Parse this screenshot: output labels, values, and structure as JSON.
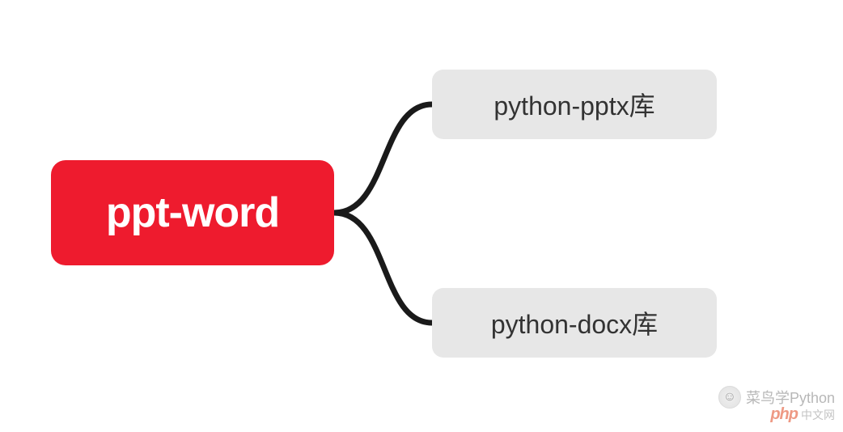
{
  "diagram": {
    "root": {
      "label": "ppt-word",
      "color": "#ee1b2e",
      "text_color": "#ffffff"
    },
    "children": [
      {
        "label": "python-pptx库",
        "color": "#e7e7e7",
        "text_color": "#333333"
      },
      {
        "label": "python-docx库",
        "color": "#e7e7e7",
        "text_color": "#333333"
      }
    ],
    "connector_color": "#1a1a1a"
  },
  "watermark": {
    "line1": "菜鸟学Python",
    "php_label": "php",
    "line2": "中文网"
  }
}
